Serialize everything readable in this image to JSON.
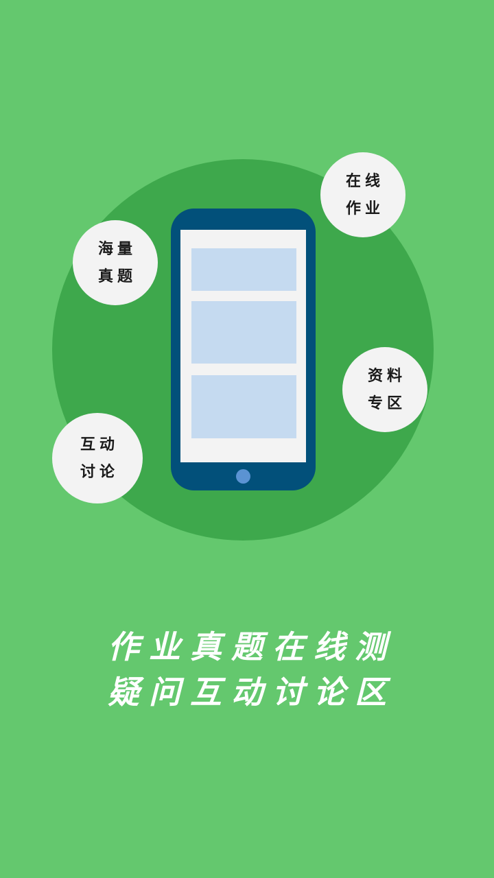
{
  "bubbles": {
    "online_homework": [
      "在线",
      "作业"
    ],
    "question_bank": [
      "海量",
      "真题"
    ],
    "resources": [
      "资料",
      "专区"
    ],
    "discussion": [
      "互动",
      "讨论"
    ]
  },
  "slogan": {
    "line1": "作业真题在线测",
    "line2": "疑问互动讨论区"
  },
  "colors": {
    "background": "#64c86e",
    "circle": "#3ea84c",
    "phone_body": "#02507a",
    "screen_block": "#c5daf0",
    "home_button": "#5b93d3"
  }
}
